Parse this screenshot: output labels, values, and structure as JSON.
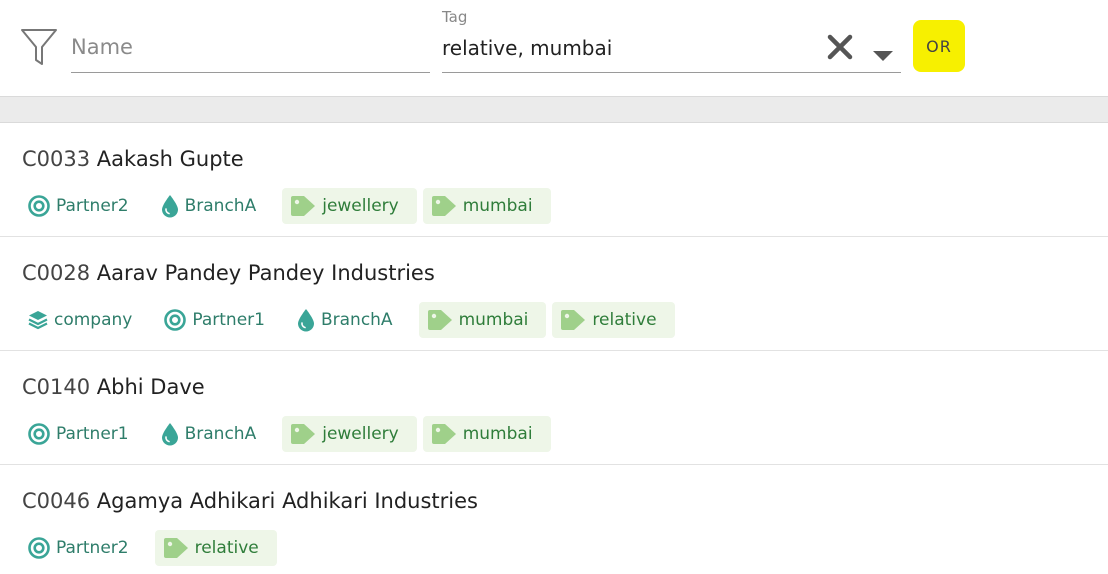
{
  "filter": {
    "name_placeholder": "Name",
    "tag_label": "Tag",
    "tag_value": "relative, mumbai",
    "or_label": "OR"
  },
  "colors": {
    "accent_teal": "#3aa597",
    "tag_bg": "#eef6e8",
    "tag_icon": "#9fd08a",
    "highlight": "#f7f000"
  },
  "customers": [
    {
      "id": "C0033",
      "name": "Aakash Gupte",
      "chips": [
        {
          "kind": "partner",
          "icon": "target-icon",
          "label": "Partner2"
        },
        {
          "kind": "branch",
          "icon": "drop-icon",
          "label": "BranchA"
        },
        {
          "kind": "tag",
          "icon": "tag-icon",
          "label": "jewellery"
        },
        {
          "kind": "tag",
          "icon": "tag-icon",
          "label": "mumbai"
        }
      ]
    },
    {
      "id": "C0028",
      "name": "Aarav Pandey Pandey Industries",
      "chips": [
        {
          "kind": "type",
          "icon": "layers-icon",
          "label": "company"
        },
        {
          "kind": "partner",
          "icon": "target-icon",
          "label": "Partner1"
        },
        {
          "kind": "branch",
          "icon": "drop-icon",
          "label": "BranchA"
        },
        {
          "kind": "tag",
          "icon": "tag-icon",
          "label": "mumbai"
        },
        {
          "kind": "tag",
          "icon": "tag-icon",
          "label": "relative"
        }
      ]
    },
    {
      "id": "C0140",
      "name": "Abhi Dave",
      "chips": [
        {
          "kind": "partner",
          "icon": "target-icon",
          "label": "Partner1"
        },
        {
          "kind": "branch",
          "icon": "drop-icon",
          "label": "BranchA"
        },
        {
          "kind": "tag",
          "icon": "tag-icon",
          "label": "jewellery"
        },
        {
          "kind": "tag",
          "icon": "tag-icon",
          "label": "mumbai"
        }
      ]
    },
    {
      "id": "C0046",
      "name": "Agamya Adhikari Adhikari Industries",
      "chips": [
        {
          "kind": "partner",
          "icon": "target-icon",
          "label": "Partner2"
        },
        {
          "kind": "tag",
          "icon": "tag-icon",
          "label": "relative"
        }
      ]
    }
  ]
}
